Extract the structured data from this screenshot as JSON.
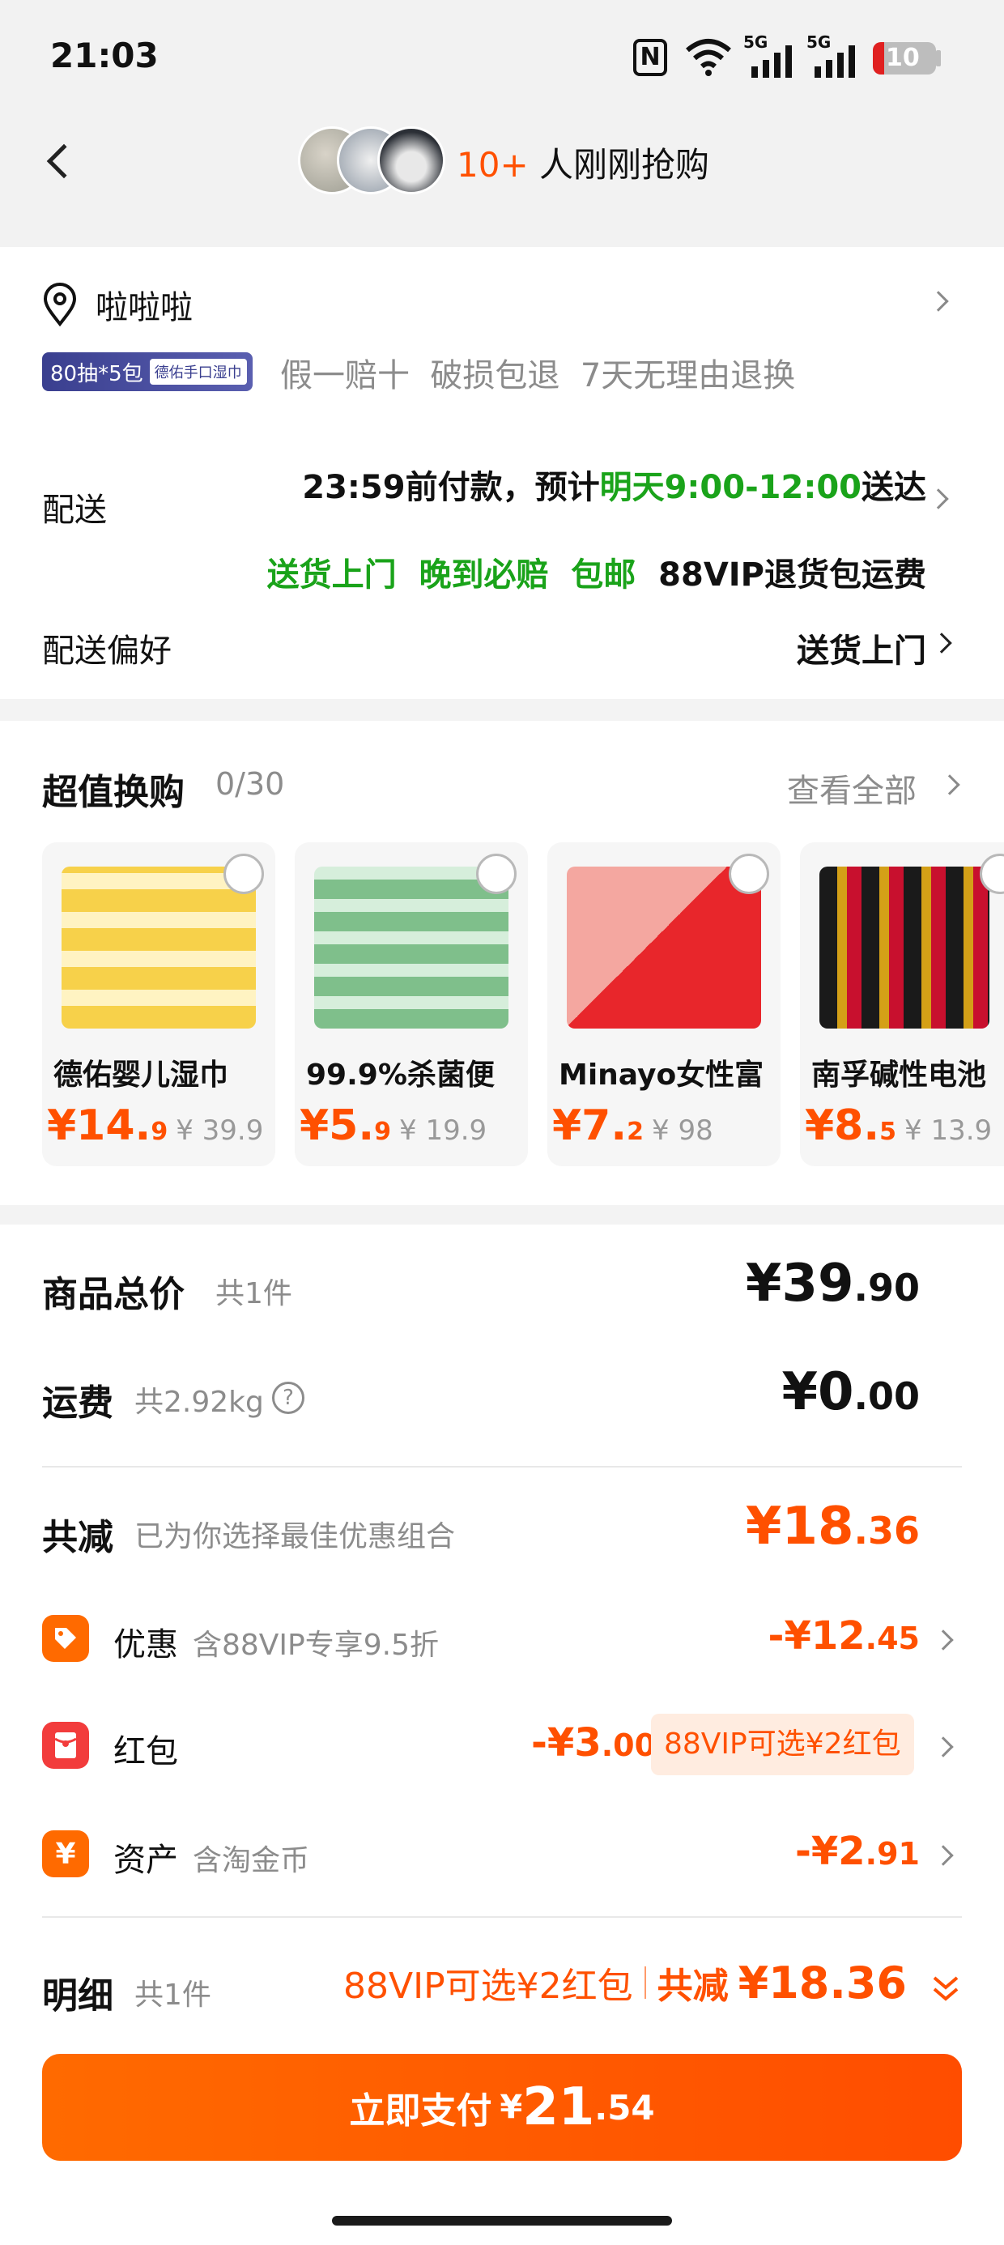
{
  "status_bar": {
    "time": "21:03",
    "nfc": "N",
    "sig1": "5G",
    "sig2": "5G",
    "battery": "10"
  },
  "header": {
    "buyers_count": "10+",
    "buyers_text": "人刚刚抢购"
  },
  "address": {
    "name": "啦啦啦",
    "tag_label": "80抽*5包",
    "tag_product": "德佑手口湿巾",
    "guarantees": "假一赔十  破损包退  7天无理由退换"
  },
  "delivery": {
    "label": "配送",
    "line1_prefix": "23:59前付款，预计",
    "line1_time": "明天9:00-12:00",
    "line1_suffix": "送达",
    "line2_green": "送货上门  晚到必赔  包邮",
    "line2_black": "88VIP退货包运费",
    "pref_label": "配送偏好",
    "pref_value": "送货上门"
  },
  "deals": {
    "title": "超值换购",
    "count": "0/30",
    "see_all": "查看全部",
    "items": [
      {
        "name": "德佑婴儿湿巾",
        "price_main": "¥14.",
        "price_dec": "9",
        "orig": "¥ 39.9"
      },
      {
        "name": "99.9%杀菌便",
        "price_main": "¥5.",
        "price_dec": "9",
        "orig": "¥ 19.9"
      },
      {
        "name": "Minayo女性富",
        "price_main": "¥7.",
        "price_dec": "2",
        "orig": "¥ 98"
      },
      {
        "name": "南孚碱性电池",
        "price_main": "¥8.",
        "price_dec": "5",
        "orig": "¥ 13.9"
      }
    ]
  },
  "summary": {
    "goods_label": "商品总价",
    "goods_count": "共1件",
    "goods_main": "¥39",
    "goods_dec": ".90",
    "ship_label": "运费",
    "ship_weight": "共2.92kg",
    "ship_help": "?",
    "ship_main": "¥0",
    "ship_dec": ".00",
    "reduce_label": "共减",
    "reduce_note": "已为你选择最佳优惠组合",
    "reduce_main": "¥18",
    "reduce_dec": ".36",
    "promo_label": "优惠",
    "promo_note": "含88VIP专享9.5折",
    "promo_main": "-¥12",
    "promo_dec": ".45",
    "redpack_label": "红包",
    "redpack_main": "-¥3",
    "redpack_dec": ".00",
    "redpack_badge": "88VIP可选¥2红包",
    "asset_label": "资产",
    "asset_note": "含淘金币",
    "asset_main": "-¥2",
    "asset_dec": ".91",
    "detail_label": "明细",
    "detail_count": "共1件",
    "detail_vip": "88VIP可选¥2红包",
    "detail_reduce_label": "共减",
    "detail_reduce_value": "¥18.36"
  },
  "pay": {
    "label": "立即支付",
    "currency": "¥",
    "main": "21",
    "dec": ".54"
  },
  "colors": {
    "accent": "#ff5000",
    "green": "#1aa31a"
  }
}
